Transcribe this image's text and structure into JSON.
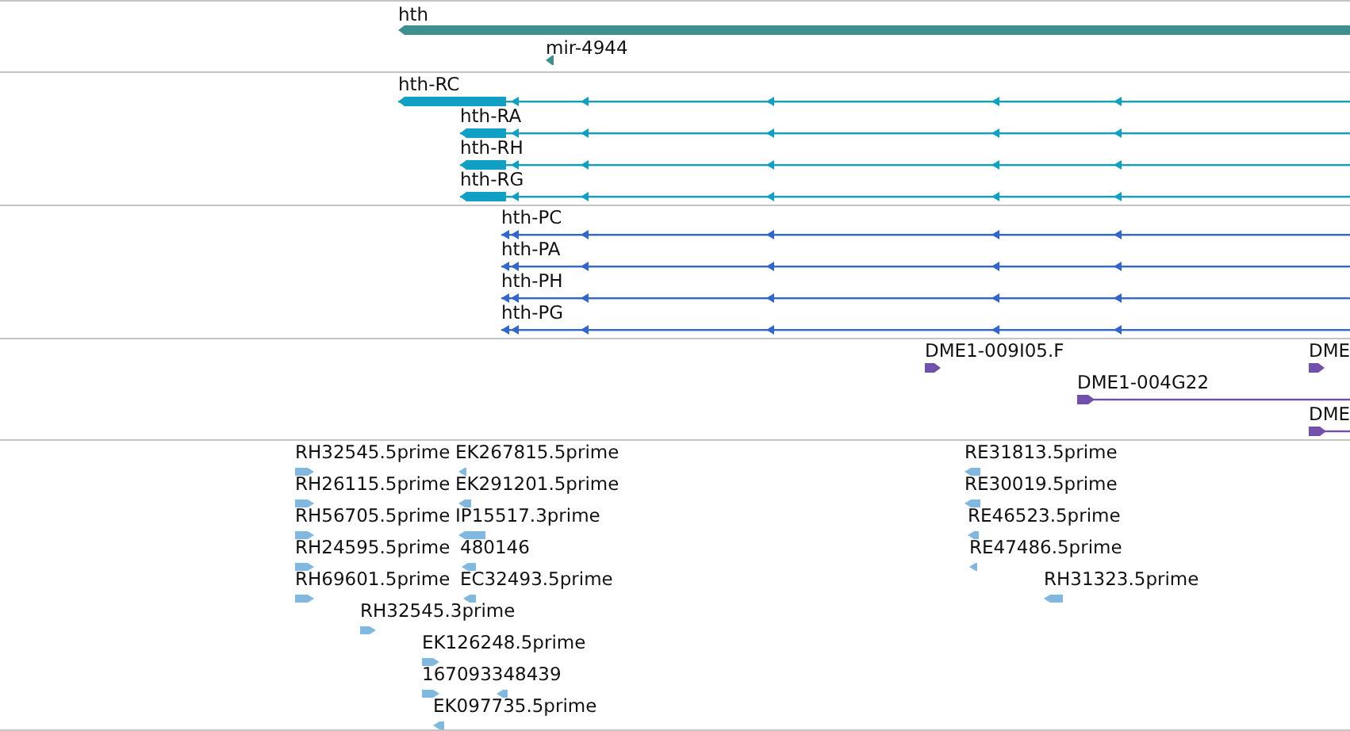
{
  "tracks": [
    {
      "kind": "gene",
      "color": "#3f8f90",
      "features": [
        {
          "label": "hth",
          "reverse": true
        },
        {
          "label": "mir-4944",
          "reverse": true
        }
      ]
    },
    {
      "kind": "transcript",
      "color": "#10a0c4",
      "features": [
        {
          "label": "hth-RC",
          "reverse": true
        },
        {
          "label": "hth-RA",
          "reverse": true
        },
        {
          "label": "hth-RH",
          "reverse": true
        },
        {
          "label": "hth-RG",
          "reverse": true
        }
      ]
    },
    {
      "kind": "transcript",
      "color": "#3366cc",
      "features": [
        {
          "label": "hth-PC",
          "reverse": true
        },
        {
          "label": "hth-PA",
          "reverse": true
        },
        {
          "label": "hth-PH",
          "reverse": true
        },
        {
          "label": "hth-PG",
          "reverse": true
        }
      ]
    },
    {
      "kind": "match",
      "color": "#7050aa",
      "features": [
        {
          "label": "DME1-009I05.F",
          "reverse": false
        },
        {
          "label": "DME",
          "reverse": false
        },
        {
          "label": "DME1-004G22",
          "reverse": false
        },
        {
          "label": "DME",
          "reverse": false
        }
      ]
    },
    {
      "kind": "est",
      "color": "#80b8e0",
      "features": [
        {
          "label": "RH32545.5prime",
          "reverse": false
        },
        {
          "label": "EK267815.5prime",
          "reverse": true
        },
        {
          "label": "RE31813.5prime",
          "reverse": true
        },
        {
          "label": "RH26115.5prime",
          "reverse": false
        },
        {
          "label": "EK291201.5prime",
          "reverse": true
        },
        {
          "label": "RE30019.5prime",
          "reverse": true
        },
        {
          "label": "RH56705.5prime",
          "reverse": false
        },
        {
          "label": "IP15517.3prime",
          "reverse": true
        },
        {
          "label": "RE46523.5prime",
          "reverse": true
        },
        {
          "label": "RH24595.5prime",
          "reverse": false
        },
        {
          "label": "480146",
          "reverse": true
        },
        {
          "label": "RE47486.5prime",
          "reverse": true
        },
        {
          "label": "RH69601.5prime",
          "reverse": false
        },
        {
          "label": "EC32493.5prime",
          "reverse": true
        },
        {
          "label": "RH31323.5prime",
          "reverse": true
        },
        {
          "label": "RH32545.3prime",
          "reverse": false
        },
        {
          "label": "EK126248.5prime",
          "reverse": false
        },
        {
          "label": "167093348439",
          "reverse": false
        },
        {
          "label": "EK097735.5prime",
          "reverse": true
        }
      ]
    }
  ]
}
